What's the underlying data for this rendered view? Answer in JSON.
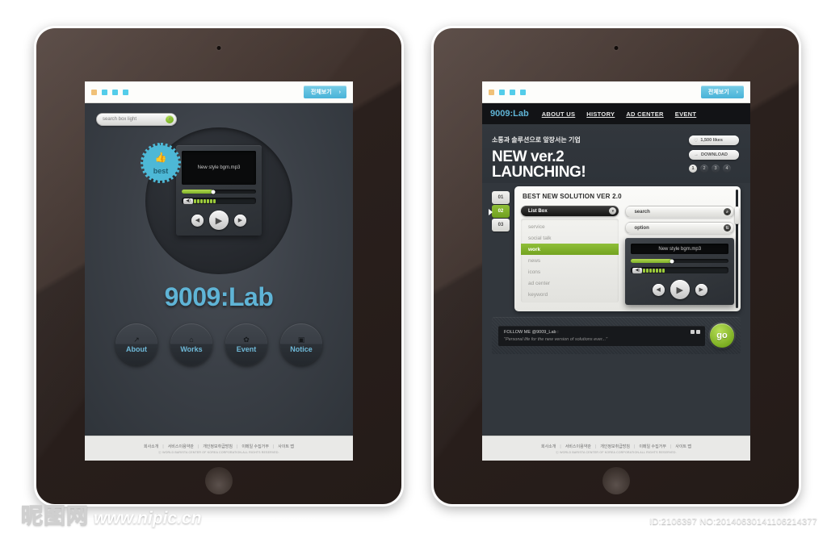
{
  "browser_chrome": {
    "dots": [
      "#f0c178",
      "#54cdea",
      "#54cdea",
      "#54cdea"
    ],
    "view_all_label": "전체보기",
    "view_all_arrow": "›"
  },
  "left_tablet": {
    "search": {
      "value": "search box light",
      "placeholder": "search box light",
      "icon": "search-icon"
    },
    "badge": {
      "icon": "thumbs-up-icon",
      "label": "best"
    },
    "player": {
      "track_title": "New style bgm.mp3",
      "progress_percent": 42,
      "volume_icon": "speaker-icon",
      "volume_segments": 7,
      "prev_icon": "◀◀",
      "play_icon": "▶",
      "next_icon": "▶▶"
    },
    "brand": "9009:Lab",
    "nav_circles": [
      {
        "label": "About",
        "icon": "arrow-up-right-icon",
        "glyph": "↗"
      },
      {
        "label": "Works",
        "icon": "home-icon",
        "glyph": "⌂"
      },
      {
        "label": "Event",
        "icon": "gear-icon",
        "glyph": "✿"
      },
      {
        "label": "Notice",
        "icon": "square-icon",
        "glyph": "▣"
      }
    ]
  },
  "right_tablet": {
    "topnav": {
      "logo": "9009:Lab",
      "items": [
        "ABOUT US",
        "HISTORY",
        "AD CENTER",
        "EVENT"
      ]
    },
    "hero": {
      "kicker": "소통과 솔루션으로 앞장서는 기업",
      "title_line1": "NEW ver.2",
      "title_line2": "LAUNCHING!",
      "likes_label": "1,500 likes",
      "likes_icon": "heart-icon",
      "download_label": "DOWNLOAD",
      "download_icon": "arrow-right-icon",
      "pager": [
        "1",
        "2",
        "3",
        "4"
      ],
      "pager_active": 0
    },
    "panel": {
      "tabs": [
        "01",
        "02",
        "03"
      ],
      "tab_active": 1,
      "heading": "BEST NEW SOLUTION VER 2.0",
      "dropdown_label": "List Box",
      "dropdown_icon": "chevron-down-icon",
      "list_items": [
        "service",
        "social talk",
        "work",
        "news",
        "icons",
        "ad center",
        "keyword"
      ],
      "list_active": 2,
      "search_field": {
        "label": "search",
        "icon": "search-icon"
      },
      "option_field": {
        "label": "option",
        "icon": "stepper-icon"
      },
      "player": {
        "track_title": "New style bgm.mp3",
        "progress_percent": 42,
        "volume_icon": "speaker-icon",
        "volume_segments": 7,
        "prev_icon": "◀◀",
        "play_icon": "▶",
        "next_icon": "▶▶"
      }
    },
    "follow": {
      "line1": "FOLLOW ME @9009_Lab :",
      "line2": "\"Personal life for the new version of solutions ever...\"",
      "go_label": "go"
    }
  },
  "footer": {
    "links": [
      "회사소개",
      "서비스이용약관",
      "개인정보취급방침",
      "이메일 수집거부",
      "사이트 맵"
    ],
    "separator": "|",
    "copyright": "ⓒ WORLD BARISTA CENTER OF KOREA CORPORATION.ALL RIGHTS RESERVED."
  },
  "watermark": {
    "site_cn": "昵图网",
    "site_url": "www.nipic.cn",
    "id_text": "ID:2106397 NO:20140630141106214377"
  }
}
